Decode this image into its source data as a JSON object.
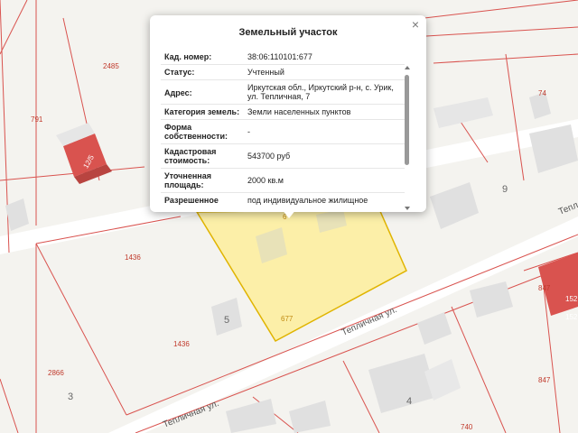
{
  "map": {
    "plot_numbers": [
      "2485",
      "791",
      "1436",
      "1436",
      "2866",
      "677",
      "74",
      "847",
      "847",
      "740",
      "152",
      "152",
      "6"
    ],
    "house_numbers": [
      "5",
      "3",
      "9",
      "4"
    ],
    "streets": [
      "Тепличная ул.",
      "Тепличная ул.",
      "Тепл"
    ],
    "building_label": "12/5",
    "colors": {
      "selected_fill": "#fcefa8",
      "selected_stroke": "#e0b400",
      "boundary": "#d9534f",
      "building_red": "#d9534f"
    }
  },
  "popup": {
    "title": "Земельный участок",
    "close_icon": "close-icon",
    "rows": [
      {
        "key": "Кад. номер:",
        "value": "38:06:110101:677"
      },
      {
        "key": "Статус:",
        "value": "Учтенный"
      },
      {
        "key": "Адрес:",
        "value": "Иркутская обл., Иркутский р-н, с. Урик, ул. Тепличная, 7"
      },
      {
        "key": "Категория земель:",
        "value": "Земли населенных пунктов"
      },
      {
        "key": "Форма собственности:",
        "value": "-"
      },
      {
        "key": "Кадастровая стоимость:",
        "value": "543700 руб"
      },
      {
        "key": "Уточненная площадь:",
        "value": "2000 кв.м"
      },
      {
        "key": "Разрешенное",
        "value": "под индивидуальное жилищное"
      }
    ]
  }
}
